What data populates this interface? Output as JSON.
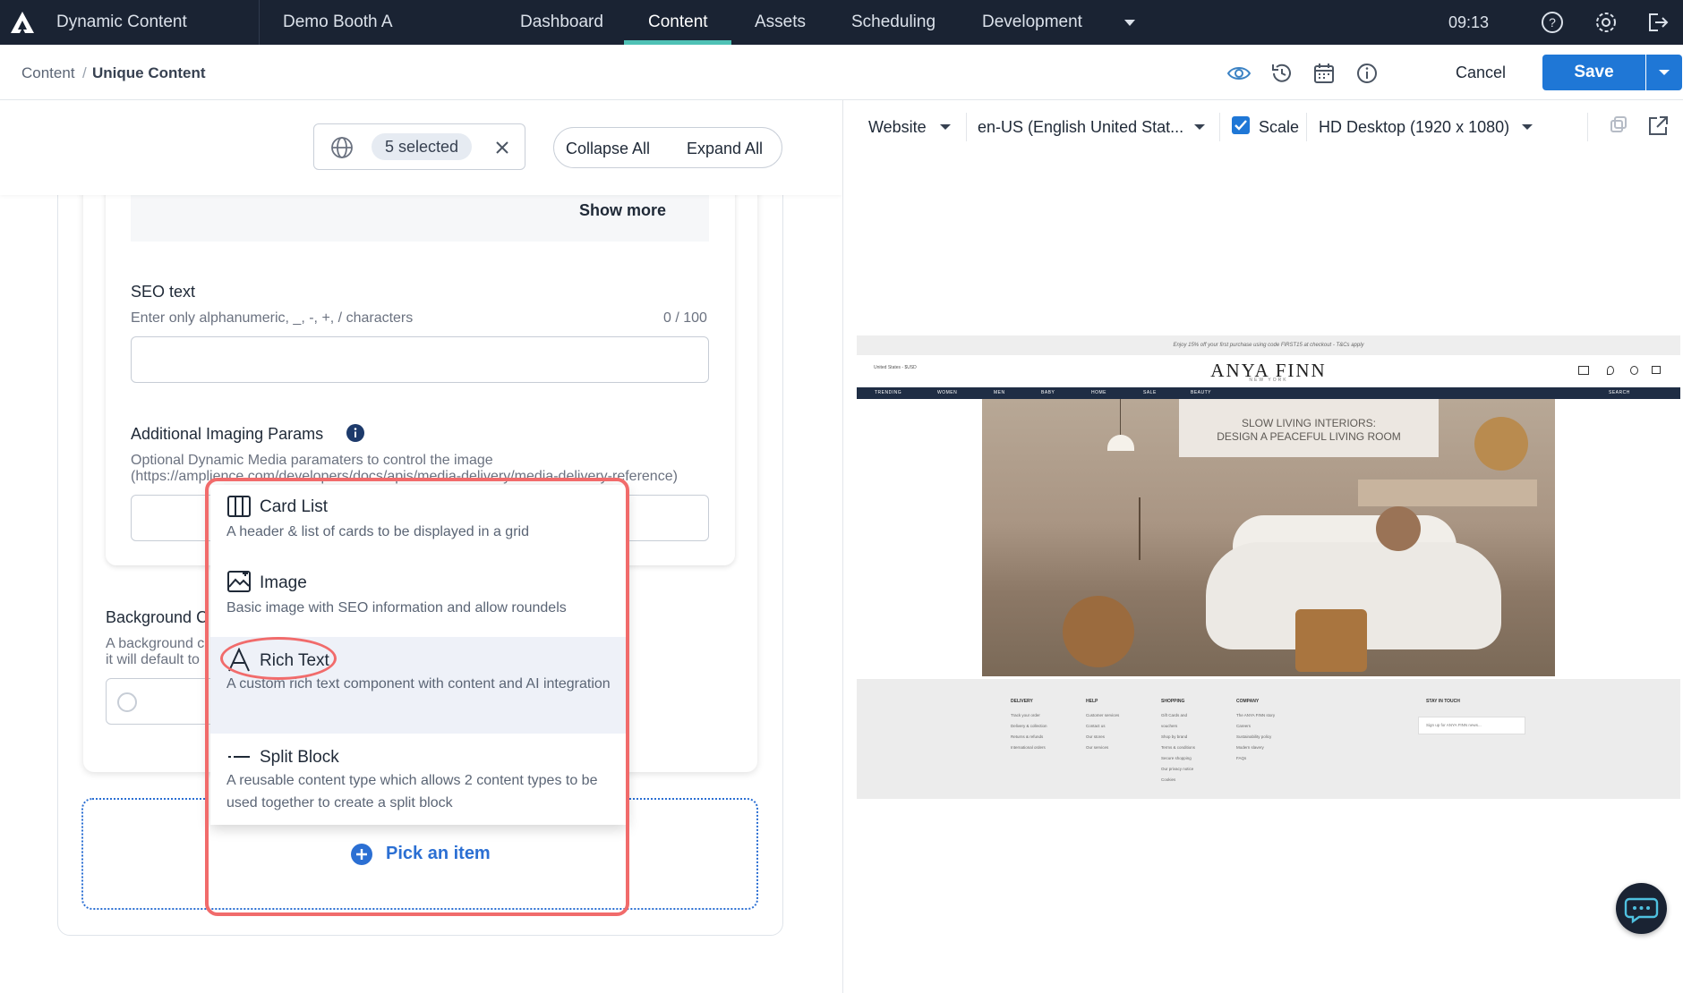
{
  "topnav": {
    "app_name": "Dynamic Content",
    "hub_name": "Demo Booth A",
    "tabs": [
      {
        "label": "Dashboard"
      },
      {
        "label": "Content"
      },
      {
        "label": "Assets"
      },
      {
        "label": "Scheduling"
      },
      {
        "label": "Development"
      }
    ],
    "active_tab": "Content",
    "clock": "09:13",
    "icons": [
      "help-icon",
      "gear-icon",
      "logout-icon"
    ],
    "active_color": "#4fc1b5"
  },
  "breadcrumb": {
    "parent": "Content",
    "separator": "/",
    "current": "Unique Content"
  },
  "header_actions": {
    "icons": [
      "eye-icon",
      "history-icon",
      "calendar-icon",
      "info-icon"
    ],
    "cancel_label": "Cancel",
    "save_label": "Save",
    "save_color": "#1f77d6"
  },
  "editor": {
    "locale_filter": {
      "chip_label": "5 selected"
    },
    "collapse_all_label": "Collapse All",
    "expand_all_label": "Expand All",
    "show_more_label": "Show more",
    "seo_text": {
      "label": "SEO text",
      "hint": "Enter only alphanumeric, _, -, +, / characters",
      "counter": "0 / 100",
      "value": ""
    },
    "imaging_params": {
      "label": "Additional Imaging Params",
      "hint_line1": "Optional Dynamic Media paramaters to control the image",
      "hint_line2": "(https://amplience.com/developers/docs/apis/media-delivery/media-delivery-reference)",
      "value": ""
    },
    "background": {
      "label": "Background C",
      "hint_line1": "A background c",
      "hint_line2": "it will default to"
    },
    "pick_item_label": "Pick an item"
  },
  "content_type_menu": {
    "items": [
      {
        "title": "Card List",
        "desc": "A header & list of cards to be displayed in a grid",
        "icon": "card-list-icon",
        "highlighted": false
      },
      {
        "title": "Image",
        "desc": "Basic image with SEO information and allow roundels",
        "icon": "image-icon",
        "highlighted": false
      },
      {
        "title": "Rich Text",
        "desc": "A custom rich text component with content and AI integration",
        "icon": "rich-text-icon",
        "highlighted": true
      },
      {
        "title": "Split Block",
        "desc": "A reusable content type which allows 2 content types to be used together to create a split block",
        "icon": "split-block-icon",
        "highlighted": false
      }
    ],
    "annotation_color": "#f16b6b"
  },
  "preview_toolbar": {
    "delivery_key": "Website",
    "locale": "en-US (English United Stat...",
    "scale_label": "Scale",
    "scale_checked": true,
    "device": "HD Desktop (1920 x 1080)",
    "icons": [
      "sync-icon",
      "open-external-icon"
    ]
  },
  "preview_site": {
    "promo": "Enjoy 15% off your first purchase using code FIRST15 at checkout - T&Cs apply",
    "country": "United States - $USD",
    "logo": "ANYA FINN",
    "logo_sub": "NEW YORK",
    "nav": [
      "TRENDING",
      "WOMEN",
      "MEN",
      "BABY",
      "HOME",
      "SALE",
      "BEAUTY"
    ],
    "search": "SEARCH",
    "hero_line1": "SLOW LIVING INTERIORS:",
    "hero_line2": "DESIGN A PEACEFUL LIVING ROOM",
    "footer": {
      "delivery": {
        "title": "DELIVERY",
        "links": [
          "Track your order",
          "Delivery & collection",
          "Returns & refunds",
          "International orders"
        ]
      },
      "help": {
        "title": "HELP",
        "links": [
          "Customer services",
          "Contact us",
          "Our stores",
          "Our services"
        ]
      },
      "shopping": {
        "title": "SHOPPING",
        "links": [
          "Gift Cards and",
          "vouchers",
          "Shop by brand",
          "Terms & conditions",
          "Secure shopping",
          "Our privacy notice",
          "Cookies"
        ]
      },
      "company": {
        "title": "COMPANY",
        "links": [
          "The ANYA FINN story",
          "Careers",
          "Sustainability policy",
          "Modern slavery",
          "FAQs"
        ]
      },
      "newsletter": {
        "title": "STAY IN TOUCH",
        "placeholder": "Sign up for ANYA FINN news..."
      }
    }
  }
}
